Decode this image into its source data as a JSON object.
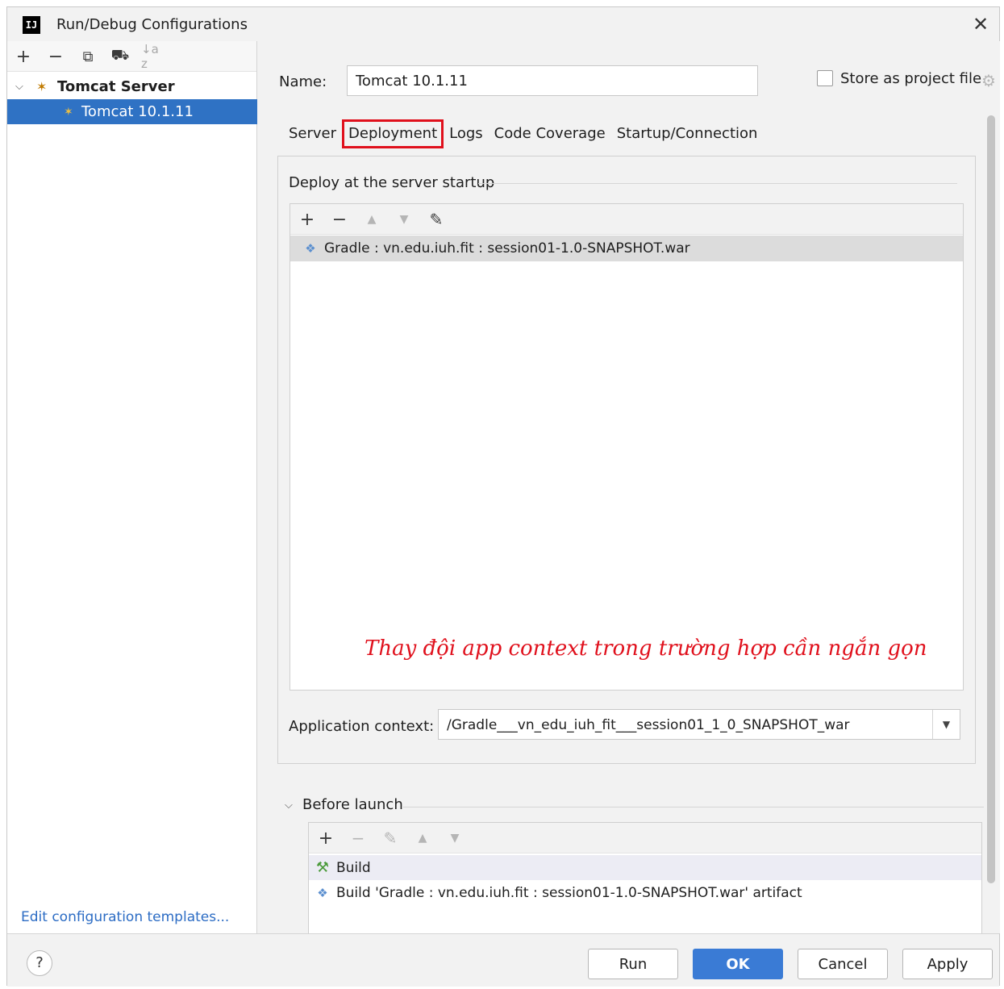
{
  "window": {
    "title": "Run/Debug Configurations",
    "app_icon": "IJ",
    "close": "✕"
  },
  "left_toolbar": {
    "add": "+",
    "remove": "−",
    "copy": "⧉",
    "move_to_folder": "⛟",
    "sort": "↓a z"
  },
  "tree": {
    "group_label": "Tomcat Server",
    "selected_item_label": "Tomcat 10.1.11"
  },
  "edit_templates_link": "Edit configuration templates...",
  "name_field": {
    "label": "Name:",
    "value": "Tomcat 10.1.11"
  },
  "store_as_project_file": {
    "label": "Store as project file",
    "checked": false
  },
  "tabs": [
    "Server",
    "Deployment",
    "Logs",
    "Code Coverage",
    "Startup/Connection"
  ],
  "active_tab": "Deployment",
  "deployment": {
    "section_title": "Deploy at the server startup",
    "artifact": "Gradle : vn.edu.iuh.fit : session01-1.0-SNAPSHOT.war",
    "annotation": "Thay đội app context trong trường hợp cần ngắn gọn",
    "app_context_label": "Application context:",
    "app_context_value": "/Gradle___vn_edu_iuh_fit___session01_1_0_SNAPSHOT_war"
  },
  "before_launch": {
    "title": "Before launch",
    "items": [
      "Build",
      "Build 'Gradle : vn.edu.iuh.fit : session01-1.0-SNAPSHOT.war' artifact"
    ]
  },
  "buttons": {
    "help": "?",
    "run": "Run",
    "ok": "OK",
    "cancel": "Cancel",
    "apply": "Apply"
  },
  "colors": {
    "selection": "#2f72c4",
    "primary_button": "#3a7bd5",
    "highlight_box": "#e0101c",
    "annotation": "#e0101c",
    "link": "#2c6cc4"
  }
}
